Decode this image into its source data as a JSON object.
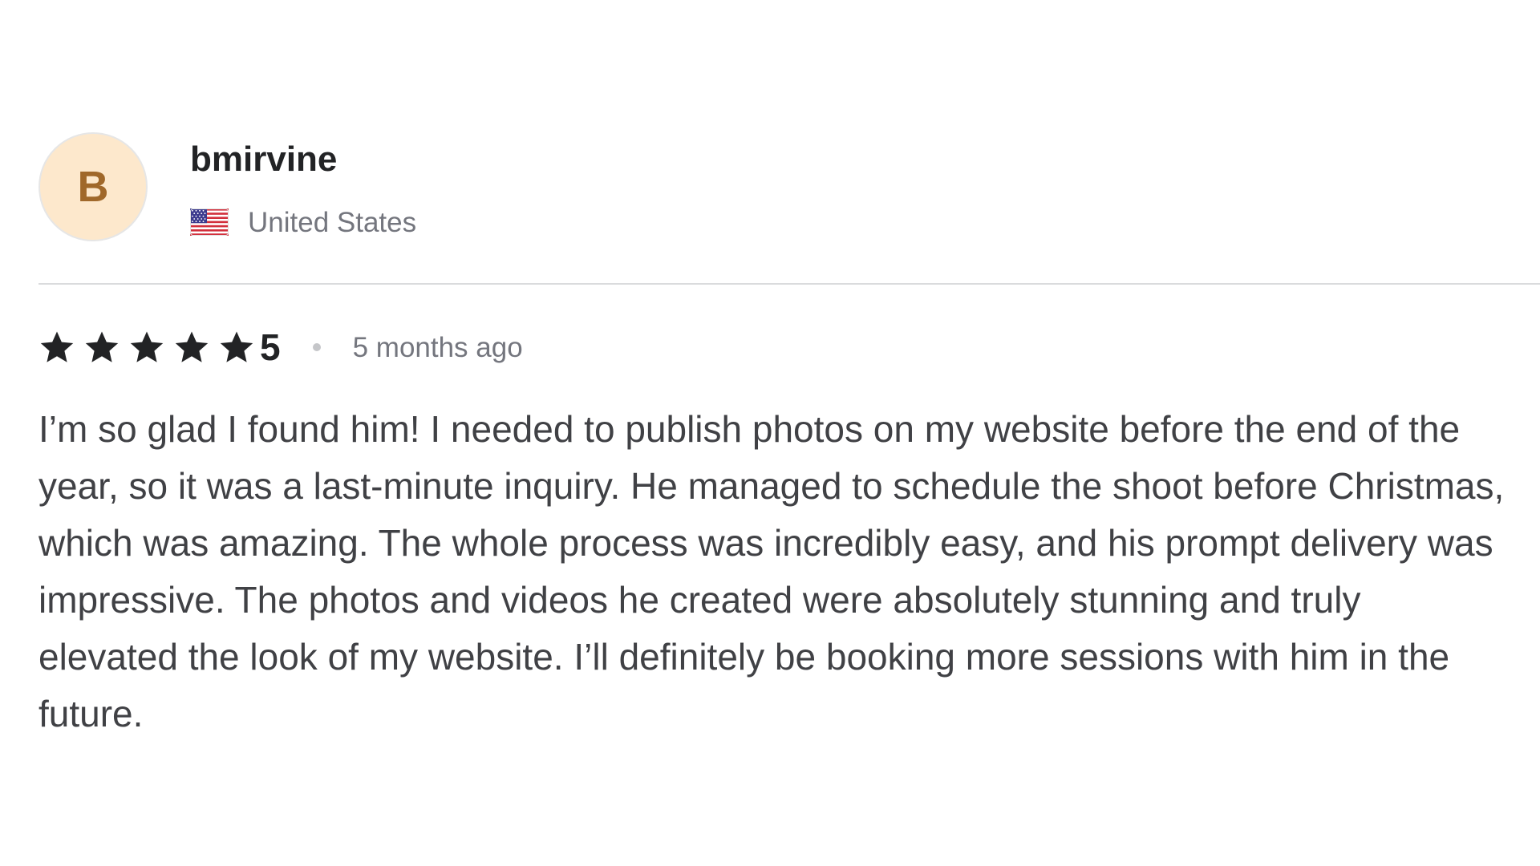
{
  "review": {
    "avatar_initial": "B",
    "username": "bmirvine",
    "country": "United States",
    "flag_icon": "us-flag-icon",
    "rating": {
      "stars_filled": 5,
      "stars_total": 5,
      "score_label": "5"
    },
    "time_ago": "5 months ago",
    "text": "I’m so glad I found him! I needed to publish photos on my website before the end of the year, so it was a last-minute inquiry. He managed to schedule the shoot before Christmas, which was amazing. The whole process was incredibly easy, and his prompt delivery was impressive. The photos and videos he created were absolutely stunning and truly elevated the look of my website. I’ll definitely be booking more sessions with him in the future."
  },
  "colors": {
    "avatar_bg": "#fde8cc",
    "avatar_letter": "#a0682a",
    "username": "#222325",
    "muted": "#74767e",
    "body": "#404145",
    "star": "#222325",
    "divider": "#dadbdd"
  }
}
